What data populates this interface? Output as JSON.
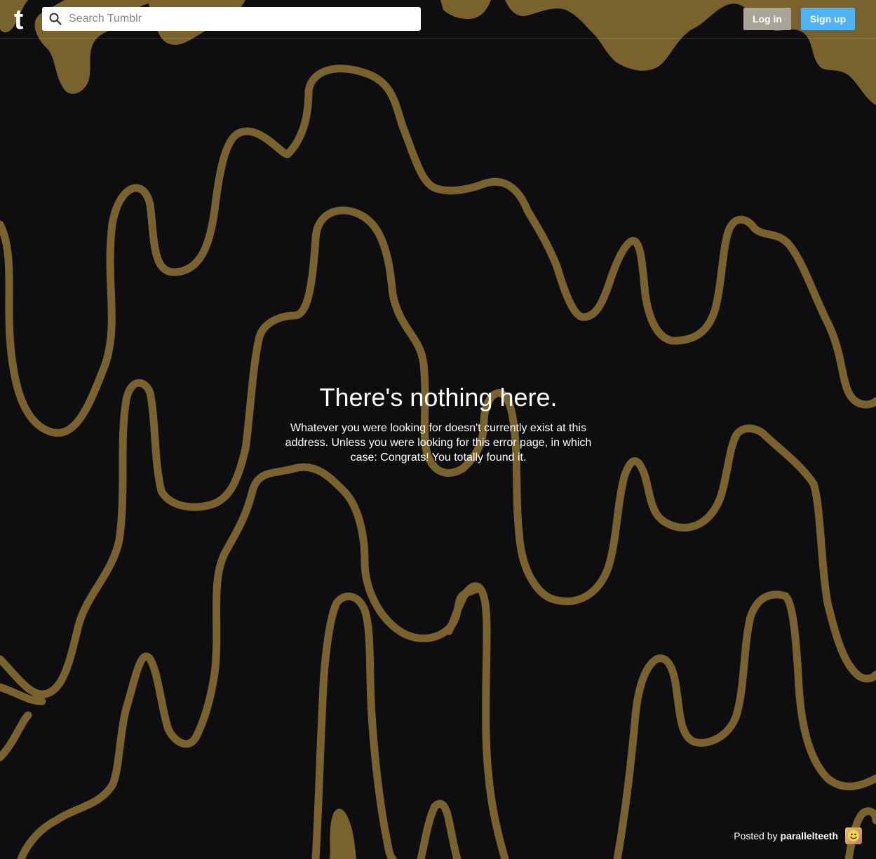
{
  "header": {
    "logo_glyph": "t",
    "search": {
      "placeholder": "Search Tumblr",
      "value": ""
    },
    "login_label": "Log in",
    "signup_label": "Sign up"
  },
  "error": {
    "title": "There's nothing here.",
    "message": "Whatever you were looking for doesn't currently exist at this address. Unless you were looking for this error page, in which case: Congrats! You totally found it."
  },
  "footer": {
    "posted_by_label": "Posted by",
    "author": "parallelteeth"
  },
  "colors": {
    "background": "#0e0d10",
    "ochre": "#7a622c",
    "login_button": "#a9a49a",
    "signup_button": "#4fb3f6"
  },
  "icons": {
    "logo": "tumblr-logo-icon",
    "search": "search-icon",
    "avatar": "smiley-avatar-icon"
  }
}
